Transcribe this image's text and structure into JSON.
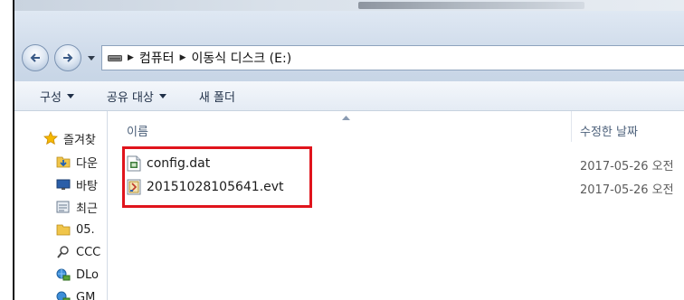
{
  "address": {
    "crumbs": [
      "컴퓨터",
      "이동식 디스크 (E:)"
    ]
  },
  "toolbar": {
    "organize_label": "구성",
    "share_label": "공유 대상",
    "new_folder_label": "새 폴더"
  },
  "nav": {
    "favorites_label": "즐겨찾",
    "items": [
      {
        "label": "다운",
        "icon": "downloads-icon"
      },
      {
        "label": "바탕",
        "icon": "desktop-icon"
      },
      {
        "label": "최근",
        "icon": "recent-places-icon"
      },
      {
        "label": "05.",
        "icon": "folder-icon"
      },
      {
        "label": "CCC",
        "icon": "search-icon"
      },
      {
        "label": "DLo",
        "icon": "network-folder-icon"
      },
      {
        "label": "GM",
        "icon": "network-folder-icon"
      }
    ]
  },
  "columns": {
    "name_label": "이름",
    "date_label": "수정한 날짜"
  },
  "files": [
    {
      "name": "config.dat",
      "date": "2017-05-26 오전",
      "icon": "dat-file-icon"
    },
    {
      "name": "20151028105641.evt",
      "date": "2017-05-26 오전",
      "icon": "evt-file-icon"
    }
  ],
  "colors": {
    "highlight": "#e0141c",
    "header_text": "#4c607a"
  }
}
